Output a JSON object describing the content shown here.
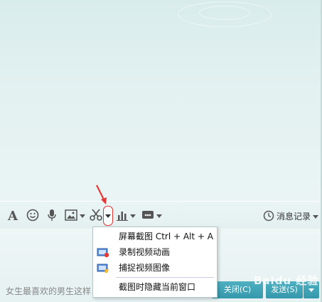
{
  "toolbar": {
    "icons": [
      "font-icon",
      "emoji-icon",
      "mic-icon",
      "image-icon",
      "scissors-icon",
      "chart-icon",
      "card-icon"
    ],
    "history_label": "消息记录"
  },
  "menu": {
    "items": [
      {
        "label": "屏幕截图 Ctrl + Alt + A",
        "icon": ""
      },
      {
        "label": "录制视频动画",
        "icon": "record-video-icon"
      },
      {
        "label": "捕捉视频图像",
        "icon": "capture-image-icon"
      },
      {
        "label": "截图时隐藏当前窗口",
        "icon": ""
      }
    ]
  },
  "input": {
    "text": "女生最喜欢的男生这样"
  },
  "buttons": {
    "close_label": "关闭(C)",
    "send_label": "发送(S)"
  },
  "watermark": {
    "text": "Baidu 经验"
  },
  "colors": {
    "accent": "#3d9fb3",
    "annotation": "#e53935"
  }
}
